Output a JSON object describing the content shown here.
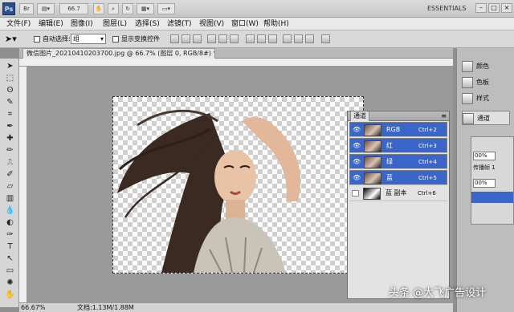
{
  "app": {
    "logo": "Ps",
    "bridge": "Br",
    "zoom": "66.7",
    "workspace": "ESSENTIALS"
  },
  "menu": [
    "文件(F)",
    "编辑(E)",
    "图像(I)",
    "图层(L)",
    "选择(S)",
    "滤镜(T)",
    "视图(V)",
    "窗口(W)",
    "帮助(H)"
  ],
  "options": {
    "auto_select_label": "自动选择:",
    "auto_select_value": "组",
    "show_transform_label": "显示变换控件"
  },
  "document": {
    "tab_title": "微信图片_20210410203700.jpg @ 66.7% (图层 0, RGB/8#) *"
  },
  "status": {
    "zoom": "66.67%",
    "doc_info": "文档:1.13M/1.88M"
  },
  "channels": {
    "title": "通道",
    "rows": [
      {
        "name": "RGB",
        "shortcut": "Ctrl+2",
        "selected": true
      },
      {
        "name": "红",
        "shortcut": "Ctrl+3",
        "selected": true
      },
      {
        "name": "绿",
        "shortcut": "Ctrl+4",
        "selected": true
      },
      {
        "name": "蓝",
        "shortcut": "Ctrl+5",
        "selected": true
      },
      {
        "name": "蓝 副本",
        "shortcut": "Ctrl+6",
        "selected": false
      }
    ]
  },
  "right_panel": {
    "color": "颜色",
    "swatches": "色板",
    "styles": "样式",
    "channels_btn": "通道",
    "opacity": "00%",
    "fill": "00%",
    "pass": "传播帧 1"
  },
  "watermark": "头条 @大飞广告设计",
  "colors": {
    "selection_blue": "#3a66c9"
  }
}
